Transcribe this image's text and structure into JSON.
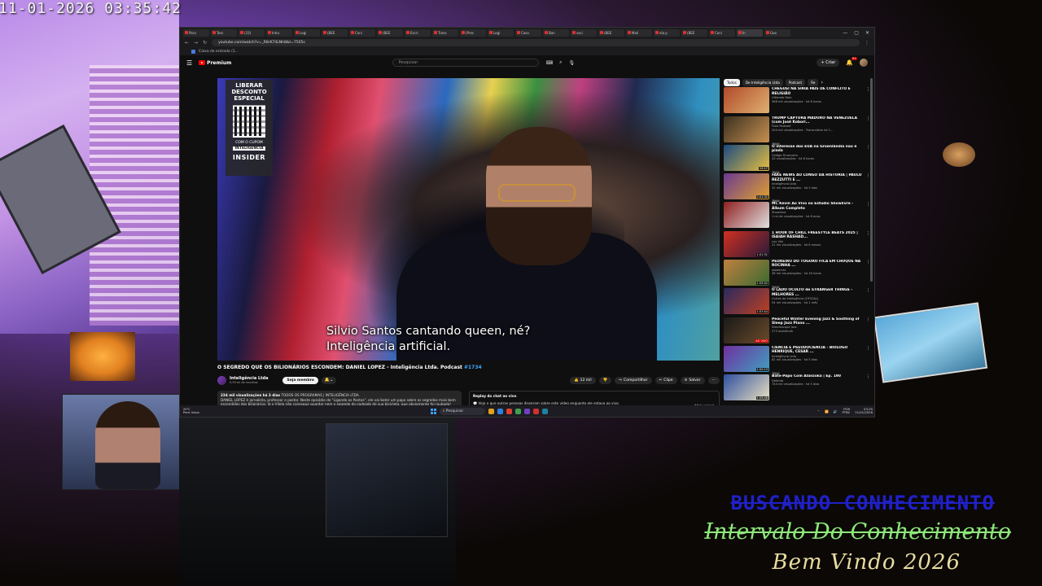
{
  "overlay": {
    "timestamp": "11-01-2026 03:35:42",
    "line1": "BUSCANDO CONHECIMENTO",
    "line2": "Intervalo Do Conhecimento",
    "line3": "Bem Vindo 2026"
  },
  "browser": {
    "tabs": [
      "Para",
      "Tess",
      "(33)",
      "Intru",
      "Logi",
      "(BEE",
      "Coni",
      "(BEE",
      "Escri",
      "Trans",
      "(Pres",
      "Logi",
      "Caso",
      "Ban",
      "soci",
      "(BEE",
      "Mail",
      "ela p",
      "(BEE",
      "Coni",
      "In",
      "Goo"
    ],
    "url": "youtube.com/watch?v=_R8rK74LNh8&t=7505s",
    "bookmark": "Caixa de entrada (1..."
  },
  "youtube": {
    "logo_text": "Premium",
    "search_placeholder": "Pesquisar",
    "create_label": "+ Criar",
    "notif_count": "9+",
    "promo": {
      "headline": "LIBERAR DESCONTO ESPECIAL",
      "coupon_prefix": "COM O CUPOM",
      "coupon_code": "INTELIGÊNCIA",
      "brand": "INSIDER"
    },
    "subtitle_line1": "Silvio Santos cantando queen, né?",
    "subtitle_line2": "Inteligência artificial.",
    "video_title": "O SEGREDO QUE OS BILIONÁRIOS ESCONDEM: DANIEL LOPEZ - Inteligência Ltda. Podcast",
    "video_tag": "#1734",
    "channel_name": "Inteligência Ltda",
    "channel_subs": "5,93 mi de inscritos",
    "member_label": "Seja membro",
    "likes": "12 mil",
    "share_label": "Compartilhar",
    "clip_label": "Clipe",
    "save_label": "Salvar",
    "desc_stats": "234 mil visualizações há 3 dias",
    "desc_tags": "TODOS OS PROGRAMAS | INTELIGÊNCIA LTDA.",
    "desc_text": "DANIEL LOPEZ é jornalista, professor e pastor. Neste episódio de \"Ligando os Pontos\", ele vai bater um papo sobre os segredos mais bem escondidos dos bilionários. Já o Vilela não consegue guardar nem o segredo do cadeado de sua bicicleta, que obviamente foi roubada! ...mais",
    "chat_title": "Replay do chat ao vivo",
    "chat_text": "Veja o que outras pessoas disseram sobre este vídeo enquanto ele estava ao vivo.",
    "chat_open": "Abrir painel",
    "chips": [
      "Todos",
      "De Inteligência Ltda",
      "Podcast",
      "Re"
    ],
    "recommendations": [
      {
        "title": "CHEGUEI NA SÍRIA PAÍS DE CONFLITO E RELIGIÃO",
        "channel": "Ultimate Rotz",
        "stats": "368 mil visualizações · há 8 horas",
        "badge": "",
        "duration": "",
        "c1": "#b04a2a",
        "c2": "#e0b070"
      },
      {
        "title": "TRUMP CAPTURA MADURO NA VENEZUELA (com José Kobori...",
        "channel": "Flow Podcast",
        "stats": "204 mil visualizações · Transmitido há 2...",
        "badge": "Novo",
        "duration": "",
        "c1": "#3a3020",
        "c2": "#c89050"
      },
      {
        "title": "O interesse dos EUA na Groenlândia não é piada",
        "channel": "Código Financeiro",
        "stats": "43 visualizações · há 8 horas",
        "badge": "Novo",
        "duration": "15:17",
        "c1": "#1a4a80",
        "c2": "#e8c040"
      },
      {
        "title": "FAKE NEWS AO LONGO DA HISTÓRIA | PAULO REZZUTTI E ...",
        "channel": "Inteligência Ltda",
        "stats": "32 mil visualizações · há 3 dias",
        "badge": "Novo",
        "duration": "2:01:32",
        "c1": "#6a3a90",
        "c2": "#e0a030"
      },
      {
        "title": "MC Kevin Ao Vivo no Estúdio Showlivre - Álbum Completo",
        "channel": "Showlivre",
        "stats": "1 mi de visualizações · há 6 anos",
        "badge": "",
        "duration": "",
        "c1": "#902020",
        "c2": "#e0e0e0"
      },
      {
        "title": "1 HOUR OF CHILL FREESTYLE BEATS 2025 | ISAIAH RASHAD...",
        "channel": "Lay Vlei",
        "stats": "21 mil visualizações · há 6 meses",
        "badge": "",
        "duration": "1:01:31",
        "c1": "#d03020",
        "c2": "#2a1a3a"
      },
      {
        "title": "PEDREIRO DO TOGURO FICA EM CHOQUE NA ROCINHA ...",
        "channel": "ubberrrzx",
        "stats": "38 mil visualizações · há 16 horas",
        "badge": "Novo",
        "duration": "1:03:42",
        "c1": "#c08040",
        "c2": "#3a6a30"
      },
      {
        "title": "O LADO OCULTO de STRANGER THINGS - MELHORES ...",
        "channel": "Cortes do Inteligência [OFICIAL]",
        "stats": "54 mil visualizações · há 1 mês",
        "badge": "",
        "duration": "1:07:44",
        "c1": "#2a2a60",
        "c2": "#c04020"
      },
      {
        "title": "Peaceful Winter Evening Jazz & Soothing of Sleep Jazz Piano ...",
        "channel": "Dreamscape Jazz",
        "stats": "273 assistindo",
        "badge": "",
        "duration": "",
        "live": "AO VIVO",
        "c1": "#1a1a1a",
        "c2": "#6a4a2a"
      },
      {
        "title": "CIÊNCIA E PSEUDOCIÊNCIA - BIÓLOGO HENRIQUE, CESAR ...",
        "channel": "Inteligência Ltda",
        "stats": "82 mil visualizações · há 5 dias",
        "badge": "Novo",
        "duration": "1:52:13",
        "c1": "#7030a0",
        "c2": "#40a0c0"
      },
      {
        "title": "Bate-Papo Com Alanzoka | Ep. 190",
        "channel": "Defante",
        "stats": "744 mil visualizações · há 5 dias",
        "badge": "",
        "duration": "1:53:48",
        "c1": "#3050a0",
        "c2": "#e8e0c0"
      }
    ]
  },
  "taskbar": {
    "weather_temp": "20°C",
    "weather_desc": "Pred. limpo",
    "search_label": "Pesquisar",
    "lang_line1": "POR",
    "lang_line2": "PTB2",
    "time": "03:35",
    "date": "11/01/2026"
  }
}
